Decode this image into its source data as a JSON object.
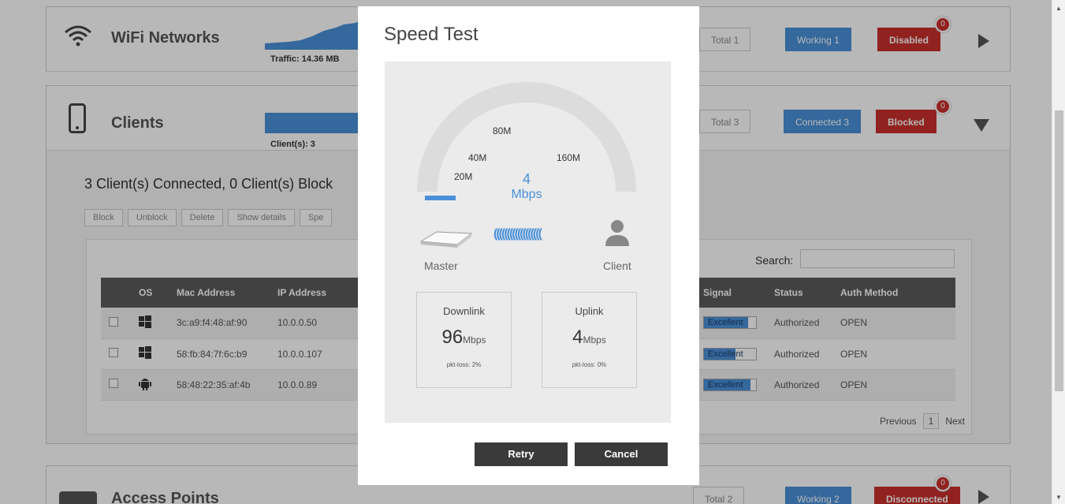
{
  "wifi": {
    "title": "WiFi Networks",
    "traffic": "Traffic: 14.36 MB",
    "total": "Total 1",
    "working": "Working 1",
    "disabled": "Disabled",
    "badge": "0"
  },
  "clients": {
    "title": "Clients",
    "count_label": "Client(s): 3",
    "total": "Total 3",
    "connected": "Connected 3",
    "blocked": "Blocked",
    "badge": "0",
    "summary": "3 Client(s) Connected, 0 Client(s) Block",
    "buttons": [
      "Block",
      "Unblock",
      "Delete",
      "Show details",
      "Spe"
    ],
    "search_label": "Search:",
    "columns": [
      "",
      "OS",
      "Mac Address",
      "IP Address",
      "",
      "Signal",
      "Status",
      "Auth Method"
    ],
    "rows": [
      {
        "os": "windows-icon",
        "mac": "3c:a9:f4:48:af:90",
        "ip": "10.0.0.50",
        "partial": "2",
        "signal": "Excellent",
        "signal_level": 0.85,
        "status": "Authorized",
        "auth": "OPEN"
      },
      {
        "os": "windows-icon",
        "mac": "58:fb:84:7f:6c:b9",
        "ip": "10.0.0.107",
        "partial": "2",
        "signal": "Excellent",
        "signal_level": 0.6,
        "status": "Authorized",
        "auth": "OPEN"
      },
      {
        "os": "android-icon",
        "mac": "58:48:22:35:af:4b",
        "ip": "10.0.0.89",
        "partial": "2",
        "signal": "Excellent",
        "signal_level": 0.9,
        "status": "Authorized",
        "auth": "OPEN"
      }
    ],
    "pager": {
      "previous": "Previous",
      "page": "1",
      "next": "Next"
    }
  },
  "access_points": {
    "title": "Access Points",
    "total": "Total 2",
    "working": "Working 2",
    "disconnected": "Disconnected",
    "badge": "0"
  },
  "modal": {
    "title": "Speed Test",
    "gauge": {
      "ticks": [
        "20M",
        "40M",
        "80M",
        "160M"
      ],
      "value": "4",
      "unit": "Mbps",
      "level": 0.03
    },
    "master_label": "Master",
    "client_label": "Client",
    "downlink": {
      "title": "Downlink",
      "value": "96",
      "unit": "Mbps",
      "loss": "pkt-loss: 2%"
    },
    "uplink": {
      "title": "Uplink",
      "value": "4",
      "unit": "Mbps",
      "loss": "pkt-loss: 0%"
    },
    "retry": "Retry",
    "cancel": "Cancel",
    "colors": {
      "accent": "#4a90d9",
      "gauge_track": "#dcdcdc",
      "button": "#3a3a3a"
    }
  }
}
